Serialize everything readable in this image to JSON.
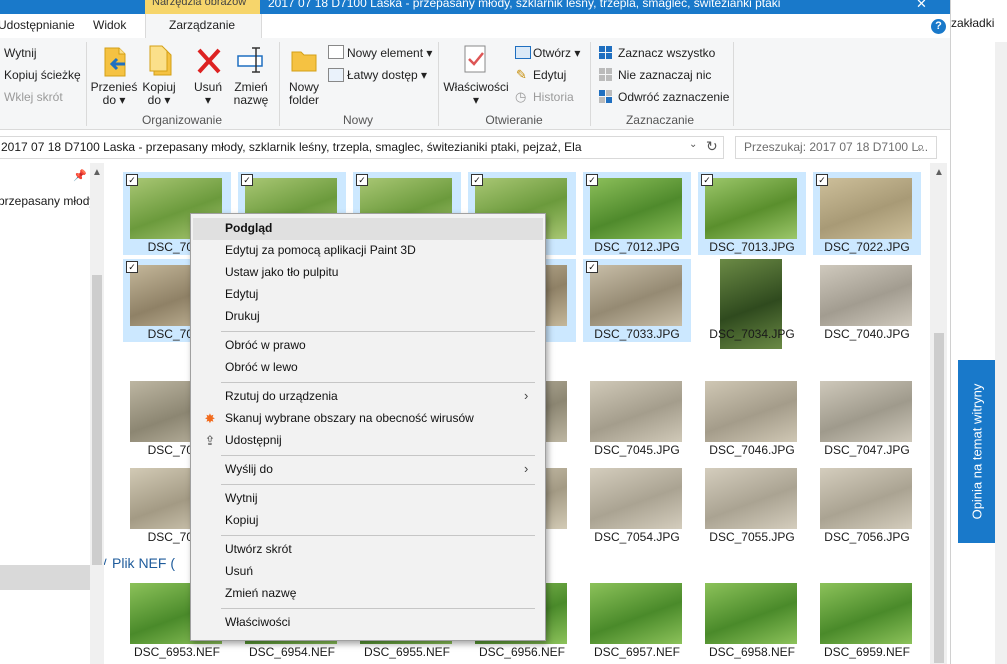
{
  "window": {
    "title": "2017 07 18 D7100 Laska - przepasany młody, szklarnik leśny, trzepla, smaglec, świtezianki ptaki",
    "contextual_tab_header": "Narzędzia obrazów",
    "close_glyph": "✕"
  },
  "tabs": [
    "Udostępnianie",
    "Widok",
    "Zarządzanie"
  ],
  "ribbon": {
    "clipboard": {
      "cut": "Wytnij",
      "copy_path": "Kopiuj ścieżkę",
      "paste_shortcut": "Wklej skrót"
    },
    "organize": {
      "move_to": [
        "Przenieś",
        "do ▾"
      ],
      "copy_to": [
        "Kopiuj",
        "do ▾"
      ],
      "delete": [
        "Usuń",
        "▾"
      ],
      "rename": [
        "Zmień",
        "nazwę"
      ],
      "group_label": "Organizowanie"
    },
    "new": {
      "new_folder": [
        "Nowy",
        "folder"
      ],
      "new_item": "Nowy element ▾",
      "easy_access": "Łatwy dostęp ▾",
      "group_label": "Nowy"
    },
    "open": {
      "properties": [
        "Właściwości",
        "▾"
      ],
      "open": "Otwórz ▾",
      "edit": "Edytuj",
      "history": "Historia",
      "group_label": "Otwieranie"
    },
    "select": {
      "select_all": "Zaznacz wszystko",
      "select_none": "Nie zaznaczaj nic",
      "invert": "Odwróć zaznaczenie",
      "group_label": "Zaznaczanie"
    }
  },
  "address": {
    "path": "2017 07 18 D7100 Laska - przepasany młody, szklarnik leśny, trzepla, smaglec, świtezianiki ptaki, pejzaż, Ela",
    "search_placeholder": "Przeszukaj: 2017 07 18 D7100 L...",
    "dropdown_glyph": "⌄",
    "refresh_glyph": "↻",
    "search_glyph": "⌕"
  },
  "nav": {
    "item": "przepasany młody, s",
    "pin_glyph": "📌"
  },
  "files": {
    "row1": [
      "DSC_7006",
      "",
      "",
      "",
      "DSC_7012.JPG",
      "DSC_7013.JPG",
      "DSC_7022.JPG"
    ],
    "row2": [
      "DSC_7023",
      "",
      "",
      "",
      "DSC_7033.JPG",
      "DSC_7034.JPG",
      "DSC_7040.JPG"
    ],
    "row3": [
      "DSC_7041",
      "",
      "",
      "",
      "DSC_7045.JPG",
      "DSC_7046.JPG",
      "DSC_7047.JPG"
    ],
    "row4": [
      "DSC_7048",
      "",
      "",
      "",
      "DSC_7054.JPG",
      "DSC_7055.JPG",
      "DSC_7056.JPG"
    ],
    "nef_group_header": "Plik NEF (",
    "row5": [
      "DSC_6953.NEF",
      "DSC_6954.NEF",
      "DSC_6955.NEF",
      "DSC_6956.NEF",
      "DSC_6957.NEF",
      "DSC_6958.NEF",
      "DSC_6959.NEF"
    ],
    "check_glyph": "✓",
    "chevron_glyph": "∨"
  },
  "context_menu": {
    "items": [
      "Podgląd",
      "Edytuj za pomocą aplikacji Paint 3D",
      "Ustaw jako tło pulpitu",
      "Edytuj",
      "Drukuj",
      "Obróć w prawo",
      "Obróć w lewo",
      "Rzutuj do urządzenia",
      "Skanuj wybrane obszary na obecność wirusów",
      "Udostępnij",
      "Wyślij do",
      "Wytnij",
      "Kopiuj",
      "Utwórz skrót",
      "Usuń",
      "Zmień nazwę",
      "Właściwości"
    ],
    "submenu_arrow": "›"
  },
  "browser": {
    "bookmarks": "zakładki",
    "feedback": "Opinia na temat witryny"
  }
}
